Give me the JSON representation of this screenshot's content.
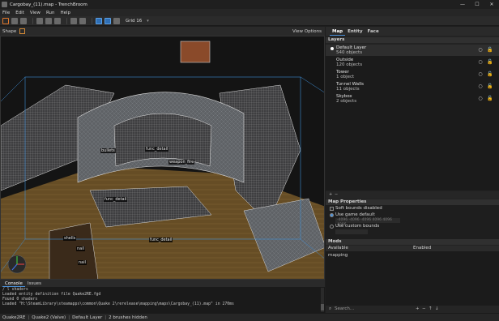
{
  "window": {
    "title": "Cargobay_(11).map - TrenchBroom",
    "controls": [
      "—",
      "☐",
      "✕"
    ]
  },
  "menu": [
    "File",
    "Edit",
    "View",
    "Run",
    "Help"
  ],
  "toolbar": {
    "grid_label": "Grid 16",
    "grid_arrow": "▾"
  },
  "viewport_header": {
    "shape_label": "Shape",
    "view_options": "View Options"
  },
  "viewport": {
    "entity_labels": [
      "bullets",
      "func_detail",
      "weapon_fire",
      "func_detail",
      "func_detail",
      "shells",
      "nail",
      "nail"
    ]
  },
  "bottom_tabs": [
    "Console",
    "Issues"
  ],
  "console_lines": [
    "/ l shaders",
    "Loaded entity definition file Quake2RE.fgd",
    "Found 0 shaders",
    "Loaded \"H:\\SteamLibrary\\steamapps\\common\\Quake 2\\rerelease\\mapping\\maps\\Cargobay_(11).map\" in 270ms"
  ],
  "status": {
    "game": "Quake2RE",
    "engine": "Quake2 (Valve)",
    "layer": "Default Layer",
    "selection": "2 brushes hidden"
  },
  "right_tabs": [
    "Map",
    "Entity",
    "Face"
  ],
  "layers": {
    "header": "Layers",
    "items": [
      {
        "name": "Default Layer",
        "count": "540 objects",
        "active": true
      },
      {
        "name": "Outside",
        "count": "120 objects",
        "active": false
      },
      {
        "name": "Tower",
        "count": "1 object",
        "active": false
      },
      {
        "name": "Tunnel Walls",
        "count": "11 objects",
        "active": false
      },
      {
        "name": "Skybox",
        "count": "2 objects",
        "active": false
      }
    ],
    "icons": {
      "visibility": "○",
      "lock": "🔓"
    },
    "footer_add": "+",
    "footer_remove": "−"
  },
  "map_properties": {
    "header": "Map Properties",
    "soft_bounds_label": "Soft bounds disabled",
    "soft_bounds_checked": false,
    "use_game_default_label": "Use game default",
    "use_game_default_checked": true,
    "game_default_value": "-4096 -4096 -4096 4096 4096 4096",
    "use_custom_label": "Use custom bounds",
    "use_custom_checked": false
  },
  "mods": {
    "header": "Mods",
    "available_label": "Available",
    "enabled_label": "Enabled",
    "available_items": [
      "mapping"
    ],
    "search_placeholder": "Search...",
    "controls": [
      "+",
      "−",
      "↑",
      "↓"
    ]
  },
  "colors": {
    "accent": "#4a90d9",
    "toolbar_icon": "#e0772b",
    "wireframe": "#d9d9d9",
    "bounds": "#3f8fd8",
    "floor_wood": "#7a5a2c",
    "stone": "#6e6e6e"
  }
}
